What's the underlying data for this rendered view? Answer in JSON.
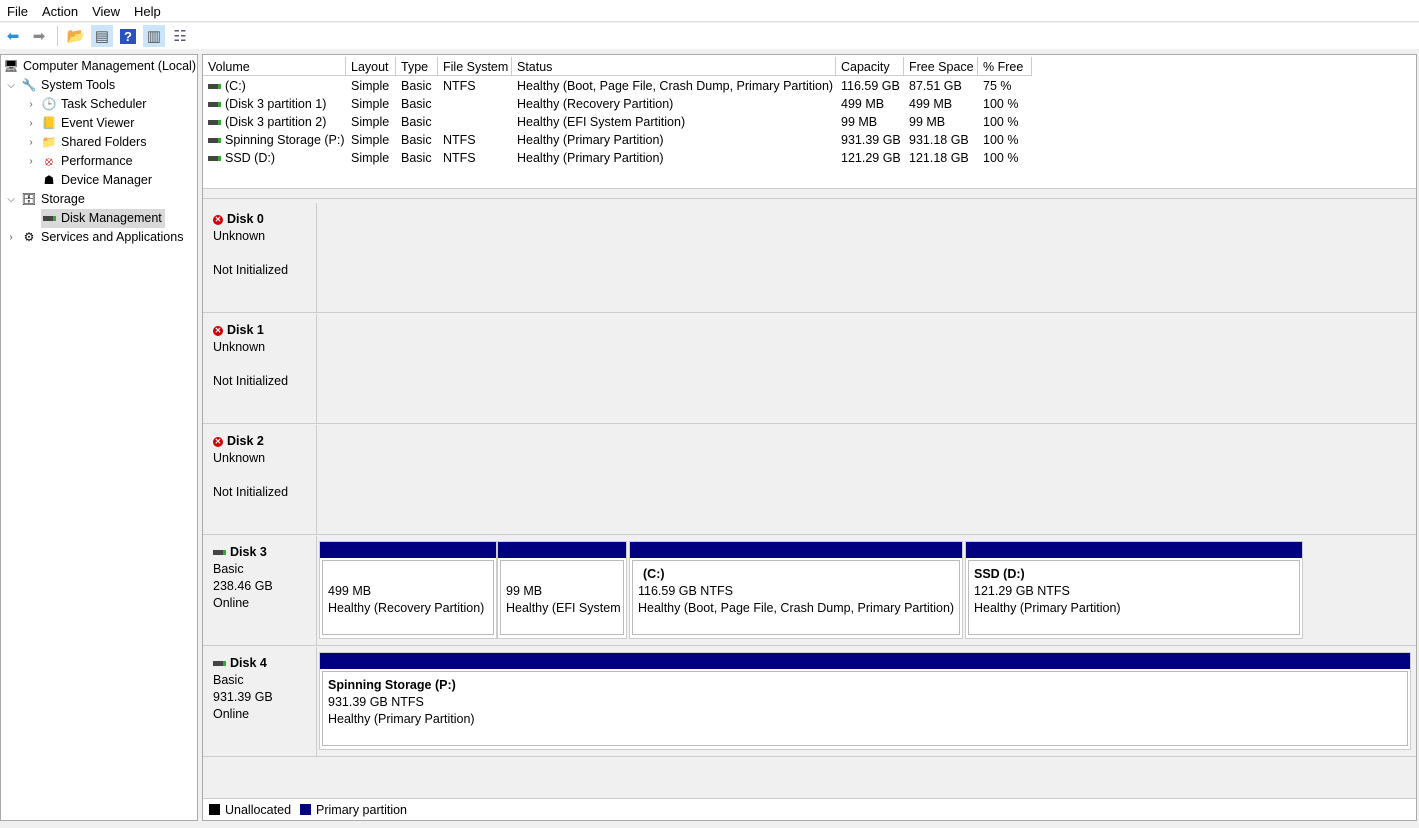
{
  "menu": [
    "File",
    "Action",
    "View",
    "Help"
  ],
  "tree": {
    "root": "Computer Management (Local)",
    "system_tools": "System Tools",
    "task_scheduler": "Task Scheduler",
    "event_viewer": "Event Viewer",
    "shared_folders": "Shared Folders",
    "performance": "Performance",
    "device_manager": "Device Manager",
    "storage": "Storage",
    "disk_management": "Disk Management",
    "services": "Services and Applications"
  },
  "columns": [
    "Volume",
    "Layout",
    "Type",
    "File System",
    "Status",
    "Capacity",
    "Free Space",
    "% Free"
  ],
  "volumes": [
    [
      "(C:)",
      "Simple",
      "Basic",
      "NTFS",
      "Healthy (Boot, Page File, Crash Dump, Primary Partition)",
      "116.59 GB",
      "87.51 GB",
      "75 %"
    ],
    [
      "(Disk 3 partition 1)",
      "Simple",
      "Basic",
      "",
      "Healthy (Recovery Partition)",
      "499 MB",
      "499 MB",
      "100 %"
    ],
    [
      "(Disk 3 partition 2)",
      "Simple",
      "Basic",
      "",
      "Healthy (EFI System Partition)",
      "99 MB",
      "99 MB",
      "100 %"
    ],
    [
      "Spinning Storage (P:)",
      "Simple",
      "Basic",
      "NTFS",
      "Healthy (Primary Partition)",
      "931.39 GB",
      "931.18 GB",
      "100 %"
    ],
    [
      "SSD (D:)",
      "Simple",
      "Basic",
      "NTFS",
      "Healthy (Primary Partition)",
      "121.29 GB",
      "121.18 GB",
      "100 %"
    ]
  ],
  "disks": [
    {
      "name": "Disk 0",
      "type": "Unknown",
      "size": "",
      "state": "Not Initialized"
    },
    {
      "name": "Disk 1",
      "type": "Unknown",
      "size": "",
      "state": "Not Initialized"
    },
    {
      "name": "Disk 2",
      "type": "Unknown",
      "size": "",
      "state": "Not Initialized"
    },
    {
      "name": "Disk 3",
      "type": "Basic",
      "size": "238.46 GB",
      "state": "Online",
      "partitions": [
        {
          "title": "",
          "size": "499 MB",
          "status": "Healthy (Recovery Partition)"
        },
        {
          "title": "",
          "size": "99 MB",
          "status": "Healthy (EFI System I"
        },
        {
          "title": "(C:)",
          "size": "116.59 GB NTFS",
          "status": "Healthy (Boot, Page File, Crash Dump, Primary Partition)"
        },
        {
          "title": "SSD  (D:)",
          "size": "121.29 GB NTFS",
          "status": "Healthy (Primary Partition)"
        }
      ]
    },
    {
      "name": "Disk 4",
      "type": "Basic",
      "size": "931.39 GB",
      "state": "Online",
      "partitions": [
        {
          "title": "Spinning Storage  (P:)",
          "size": "931.39 GB NTFS",
          "status": "Healthy (Primary Partition)"
        }
      ]
    }
  ],
  "legend": {
    "unallocated": "Unallocated",
    "primary": "Primary partition"
  },
  "colors": {
    "primary": "#000080",
    "unallocated": "#000000"
  }
}
